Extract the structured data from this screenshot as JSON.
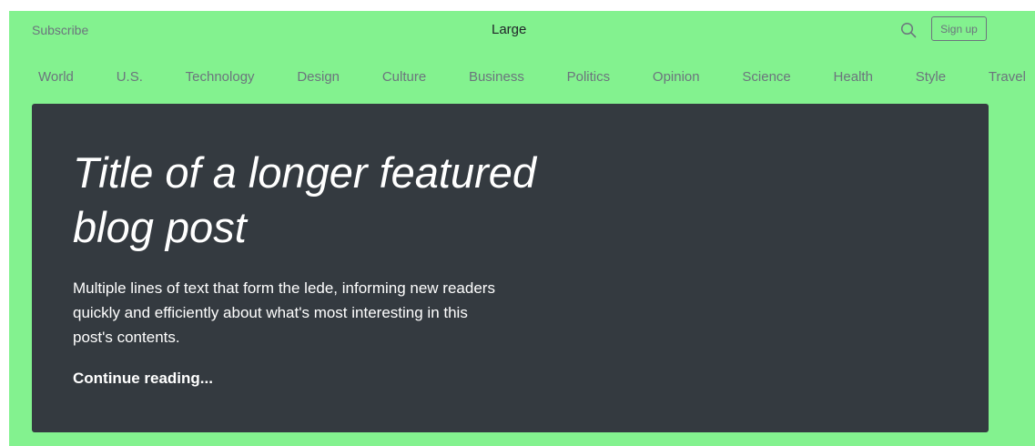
{
  "header": {
    "subscribe_label": "Subscribe",
    "brand": "Large",
    "search_icon": "search-icon",
    "signup_label": "Sign up"
  },
  "nav": {
    "items": [
      "World",
      "U.S.",
      "Technology",
      "Design",
      "Culture",
      "Business",
      "Politics",
      "Opinion",
      "Science",
      "Health",
      "Style",
      "Travel"
    ]
  },
  "hero": {
    "title": "Title of a longer featured blog post",
    "lede": "Multiple lines of text that form the lede, informing new readers quickly and efficiently about what's most interesting in this post's contents.",
    "link_label": "Continue reading..."
  },
  "colors": {
    "page_background": "#83f28f",
    "hero_background": "#343a40",
    "muted_text": "#6c757d",
    "hero_text": "#ffffff"
  }
}
